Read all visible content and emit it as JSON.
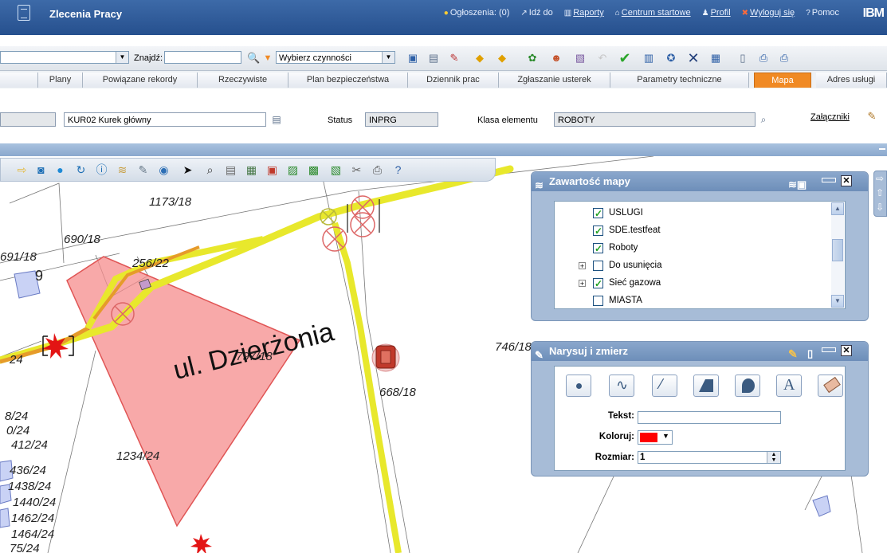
{
  "header": {
    "title": "Zlecenia Pracy",
    "nav": [
      {
        "label": "Ogłoszenia: (0)",
        "icon": "alert-icon"
      },
      {
        "label": "Idź do",
        "icon": "goto-icon"
      },
      {
        "label": "Raporty",
        "icon": "reports-icon"
      },
      {
        "label": "Centrum startowe",
        "icon": "home-icon"
      },
      {
        "label": "Profil",
        "icon": "profile-icon"
      },
      {
        "label": "Wyloguj się",
        "icon": "logout-icon"
      },
      {
        "label": "Pomoc",
        "icon": "help-icon"
      }
    ],
    "brand": "IBM"
  },
  "toolbar": {
    "find_label": "Znajdź:",
    "action_select": "Wybierz czynności"
  },
  "tabs": [
    "Plany",
    "Powiązane rekordy",
    "Rzeczywiste",
    "Plan bezpieczeństwa",
    "Dziennik prac",
    "Zgłaszanie usterek",
    "Parametry techniczne",
    "Mapa",
    "Adres usługi"
  ],
  "active_tab": "Mapa",
  "form": {
    "asset_value": "KUR02 Kurek główny",
    "status_label": "Status",
    "status_value": "INPRG",
    "class_label": "Klasa elementu",
    "class_value": "ROBOTY",
    "attachments_link": "Załączniki"
  },
  "map": {
    "street": "ul. Dzierżonia",
    "parcels": [
      "1173/18",
      "690/18",
      "691/18",
      "9",
      "256/22",
      "797/18",
      "746/18",
      "668/18",
      "24",
      "1234/24",
      "8/24",
      "0/24",
      "412/24",
      "436/24",
      "1438/24",
      "1440/24",
      "1462/24",
      "1464/24",
      "75/24"
    ]
  },
  "layers_panel": {
    "title": "Zawartość mapy",
    "items": [
      {
        "label": "USLUGI",
        "checked": true,
        "expandable": false
      },
      {
        "label": "SDE.testfeat",
        "checked": true,
        "expandable": false
      },
      {
        "label": "Roboty",
        "checked": true,
        "expandable": false
      },
      {
        "label": "Do usunięcia",
        "checked": false,
        "expandable": true
      },
      {
        "label": "Sieć gazowa",
        "checked": true,
        "expandable": true
      },
      {
        "label": "MIASTA",
        "checked": false,
        "expandable": false
      }
    ]
  },
  "draw_panel": {
    "title": "Narysuj i zmierz",
    "text_label": "Tekst:",
    "color_label": "Koloruj:",
    "color_value": "#ff0000",
    "size_label": "Rozmiar:",
    "size_value": "1"
  },
  "colors": {
    "accent": "#f08a24",
    "road_yellow": "#e8e82c",
    "road_orange": "#e69b2a",
    "polygon": "#f58c8c"
  }
}
